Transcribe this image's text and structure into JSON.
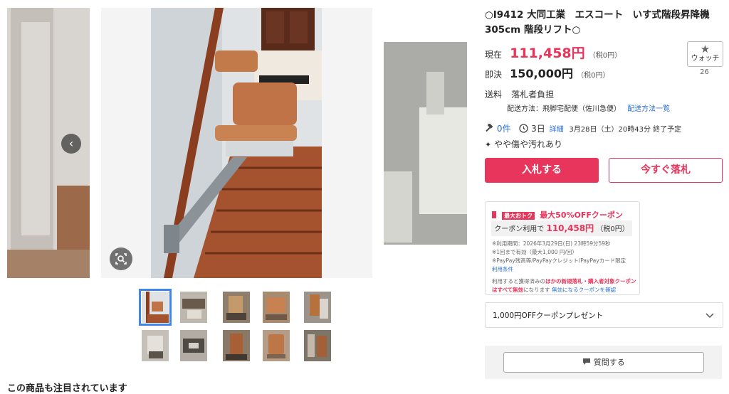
{
  "listing": {
    "title": "○I9412 大同工業　エスコート　いす式階段昇降機　305cm 階段リフト○",
    "current_label": "現在",
    "current_price": "111,458円",
    "current_tax": "（税0円）",
    "bin_label": "即決",
    "bin_price": "150,000円",
    "bin_tax": "（税0円）",
    "shipping_label": "送料",
    "shipping_value": "落札者負担",
    "delivery_method": "配送方法：飛脚宅配便（佐川急便）",
    "delivery_link": "配送方法一覧",
    "bids": "0件",
    "time_left": "3日",
    "detail_link": "詳細",
    "end_time": "3月28日（土）20時43分 終了予定",
    "condition": "やや傷や汚れあり"
  },
  "watch": {
    "label": "ウォッチ",
    "count": "26"
  },
  "buttons": {
    "bid": "入札する",
    "buy_now": "今すぐ落札"
  },
  "coupon": {
    "badge": "最大おトク",
    "headline": "最大50%OFFクーポン",
    "use_prefix": "クーポン利用で",
    "use_price": "110,458円",
    "use_tax": "（税0円）",
    "fine1": "※利用期間：2026年3月29日(日) 23時59分59秒",
    "fine2": "※1回まで有効（最大1,000 円/回）",
    "fine3": "※PayPay残高等/PayPayクレジット/PayPayカード限定",
    "terms_link": "利用条件",
    "warn1": "利用すると獲得済みの",
    "warn_red": "ほかの新規落札・購入者対象クーポンはすべて無効",
    "warn2": "になります",
    "warn_link": "無効になるクーポンを確認"
  },
  "present": {
    "label": "1,000円OFFクーポンプレゼント"
  },
  "question": {
    "label": "質問する"
  },
  "gallery": {
    "thumb_count": 10,
    "selected": 0
  },
  "related": {
    "heading": "この商品も注目されています"
  },
  "icons": [
    "chevron-left-icon",
    "chevron-right-icon",
    "image-search-icon",
    "star-icon",
    "gavel-icon",
    "clock-icon",
    "sparkle-icon",
    "chevron-down-icon",
    "chat-icon"
  ],
  "colors": {
    "accent": "#e8355b",
    "link": "#2a6fd6",
    "selected_thumb": "#3f86e8"
  }
}
